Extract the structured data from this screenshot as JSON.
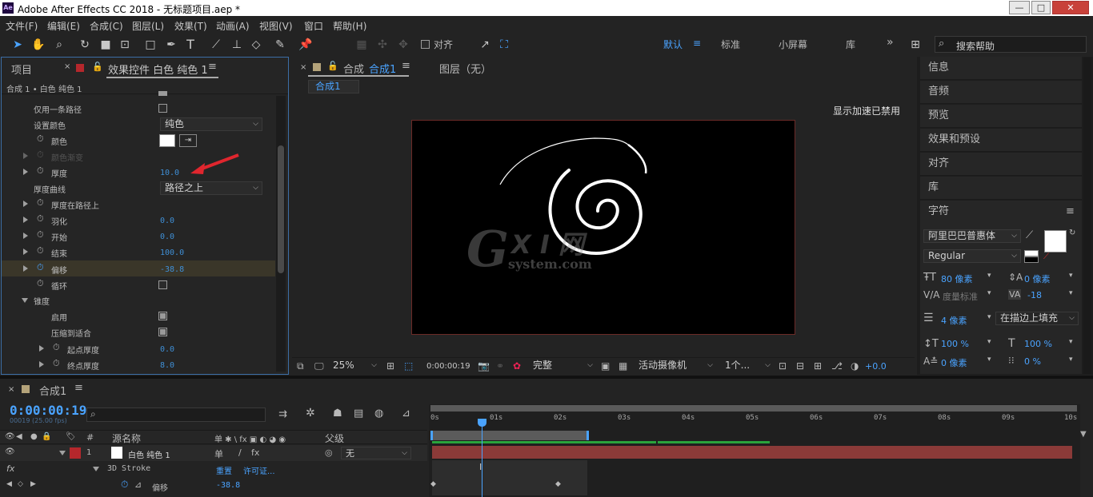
{
  "window": {
    "title": "Adobe After Effects CC 2018 - 无标题项目.aep *",
    "app_icon": "Ae"
  },
  "menu": [
    "文件(F)",
    "编辑(E)",
    "合成(C)",
    "图层(L)",
    "效果(T)",
    "动画(A)",
    "视图(V)",
    "窗口",
    "帮助(H)"
  ],
  "toolbar": {
    "snap_label": "对齐",
    "workspaces": [
      "默认",
      "标准",
      "小屏幕",
      "库"
    ],
    "more": "»",
    "search_placeholder": "搜索帮助"
  },
  "left_panel": {
    "tab_project": "项目",
    "tab_effects": "效果控件 白色 纯色 1",
    "breadcrumb": "合成 1 • 白色 纯色 1",
    "props": [
      {
        "label": "仅用一条路径",
        "type": "checkbox",
        "checked": false
      },
      {
        "label": "设置颜色",
        "type": "dropdown",
        "value": "纯色"
      },
      {
        "label": "颜色",
        "type": "color"
      },
      {
        "label": "颜色渐变",
        "type": "disabled"
      },
      {
        "label": "厚度",
        "type": "number",
        "value": "10.0"
      },
      {
        "label": "厚度曲线",
        "type": "dropdown",
        "value": "路径之上"
      },
      {
        "label": "厚度在路径上",
        "type": "group"
      },
      {
        "label": "羽化",
        "type": "number",
        "value": "0.0"
      },
      {
        "label": "开始",
        "type": "number",
        "value": "0.0"
      },
      {
        "label": "结束",
        "type": "number",
        "value": "100.0"
      },
      {
        "label": "偏移",
        "type": "number",
        "value": "-38.8"
      },
      {
        "label": "循环",
        "type": "checkbox",
        "checked": false
      },
      {
        "label": "锥度",
        "type": "section"
      },
      {
        "label": "启用",
        "type": "checkbox",
        "checked": true
      },
      {
        "label": "压缩到适合",
        "type": "checkbox",
        "checked": true
      },
      {
        "label": "起点厚度",
        "type": "number",
        "value": "0.0"
      },
      {
        "label": "终点厚度",
        "type": "number",
        "value": "8.0"
      }
    ]
  },
  "viewer": {
    "tab_label": "合成",
    "tab_name": "合成1",
    "layer_tab": "图层（无）",
    "comp_chip": "合成1",
    "accel_notice": "显示加速已禁用",
    "watermark_g": "G",
    "watermark_xi": "X I 网",
    "watermark_sub": "system.com",
    "footer": {
      "zoom": "25%",
      "timecode": "0:00:00:19",
      "quality": "完整",
      "camera": "活动摄像机",
      "views": "1个...",
      "exposure": "+0.0"
    }
  },
  "right_panel": {
    "items": [
      "信息",
      "音频",
      "预览",
      "效果和预设",
      "对齐",
      "库",
      "字符"
    ],
    "char": {
      "font": "阿里巴巴普惠体",
      "style": "Regular",
      "size": "80 像素",
      "leading": "0 像素",
      "kerning": "度量标准",
      "tracking": "-18",
      "stroke": "4 像素",
      "stroke_mode": "在描边上填充",
      "vscale": "100 %",
      "hscale": "100 %",
      "baseline": "0 像素",
      "tsume": "0 %"
    }
  },
  "timeline": {
    "comp_tab": "合成1",
    "timecode": "0:00:00:19",
    "sub_timecode": "00019 (25.00 fps)",
    "search_placeholder": "",
    "col_num": "#",
    "col_source": "源名称",
    "col_switches": "单 ✱ \\ fx ▣ ◐ ◕ ◉",
    "col_parent": "父级",
    "layer": {
      "num": "1",
      "name": "白色 纯色 1",
      "parent": "无"
    },
    "effect": {
      "name": "3D Stroke",
      "reset": "重置",
      "license": "许可证..."
    },
    "prop": {
      "name": "偏移",
      "value": "-38.8"
    },
    "ruler": [
      "0s",
      "01s",
      "02s",
      "03s",
      "04s",
      "05s",
      "06s",
      "07s",
      "08s",
      "09s",
      "10s"
    ]
  },
  "colors": {
    "accent": "#3f8fd6",
    "label_red": "#b5272c",
    "panel": "#232323",
    "layer_bar": "#8b3a38"
  }
}
